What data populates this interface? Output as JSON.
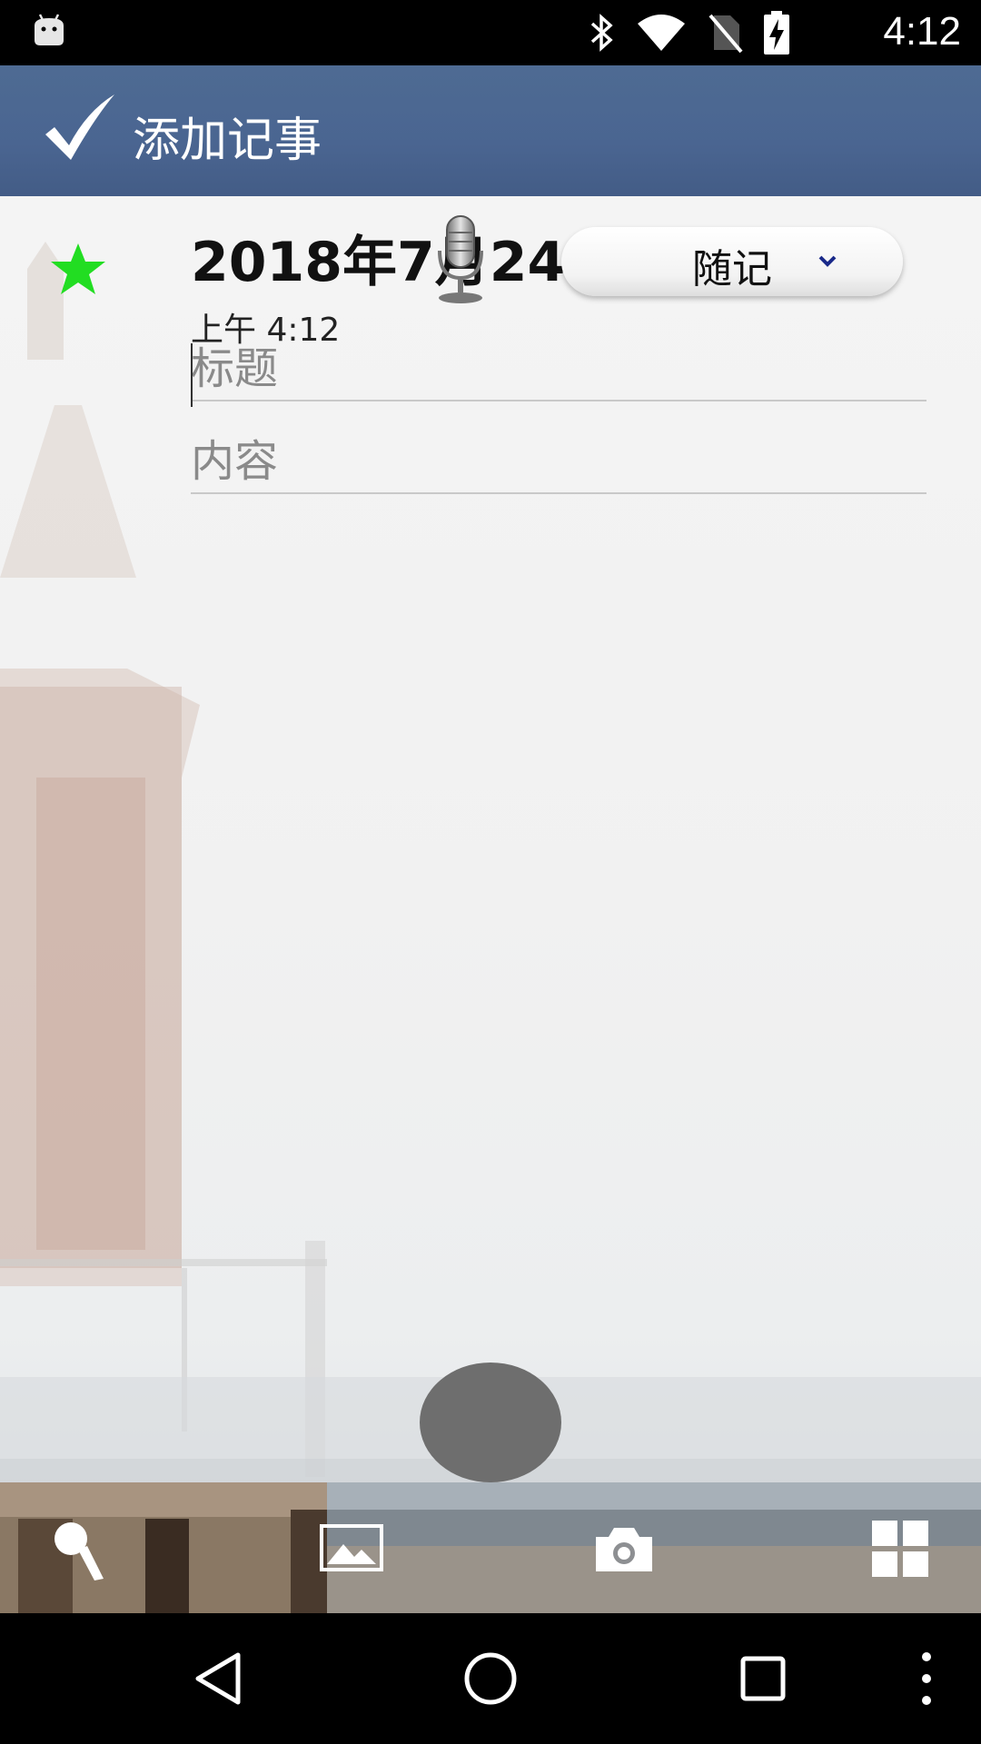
{
  "status_bar": {
    "time": "4:12",
    "icons": [
      "android-icon",
      "bluetooth-icon",
      "wifi-icon",
      "no-sim-icon",
      "battery-charging-icon"
    ]
  },
  "action_bar": {
    "title": "添加记事",
    "confirm_icon": "checkmark-icon"
  },
  "note": {
    "date": "2018年7月24日",
    "time": "上午 4:12",
    "category": "随记",
    "title_placeholder": "标题",
    "content_placeholder": "内容",
    "starred_color": "#22dd22"
  },
  "toolbar": {
    "tools": [
      "draw-icon",
      "image-icon",
      "camera-icon",
      "grid-icon"
    ]
  },
  "nav_bar": {
    "buttons": [
      "back-icon",
      "home-icon",
      "recent-apps-icon",
      "menu-icon"
    ]
  }
}
